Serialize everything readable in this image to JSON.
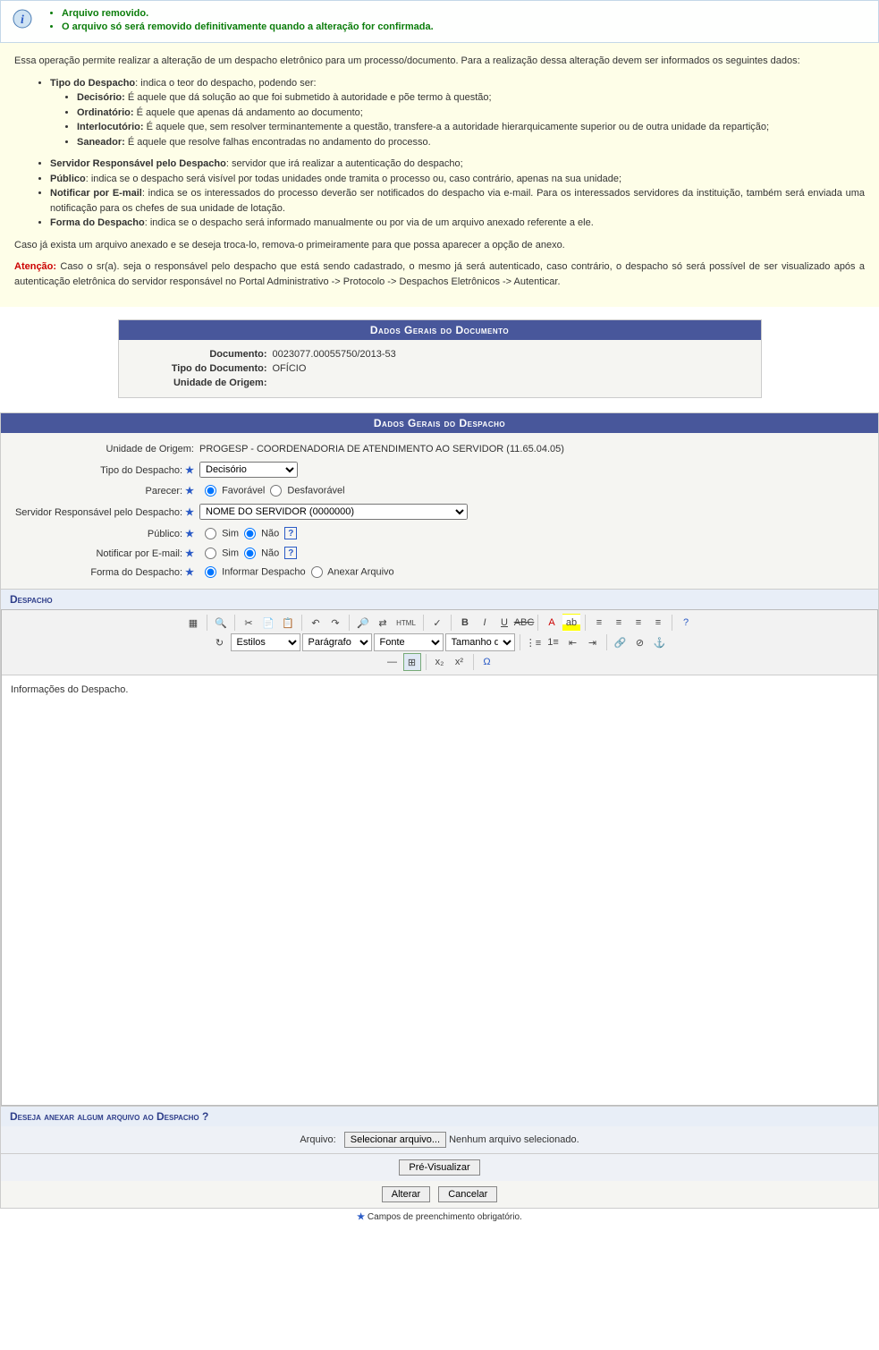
{
  "info_messages": [
    "Arquivo removido.",
    "O arquivo só será removido definitivamente quando a alteração for confirmada."
  ],
  "instructions": {
    "intro": "Essa operação permite realizar a alteração de um despacho eletrônico para um processo/documento. Para a realização dessa alteração devem ser informados os seguintes dados:",
    "items": {
      "tipo_despacho": {
        "label": "Tipo do Despacho",
        "text": ": indica o teor do despacho, podendo ser:"
      },
      "decisorio": {
        "label": "Decisório:",
        "text": " É aquele que dá solução ao que foi submetido à autoridade e põe termo à questão;"
      },
      "ordinatorio": {
        "label": "Ordinatório:",
        "text": " É aquele que apenas dá andamento ao documento;"
      },
      "interlocutorio": {
        "label": "Interlocutório:",
        "text": " É aquele que, sem resolver terminantemente a questão, transfere-a a autoridade hierarquicamente superior ou de outra unidade da repartição;"
      },
      "saneador": {
        "label": "Saneador:",
        "text": " É aquele que resolve falhas encontradas no andamento do processo."
      },
      "servidor": {
        "label": "Servidor Responsável pelo Despacho",
        "text": ": servidor que irá realizar a autenticação do despacho;"
      },
      "publico": {
        "label": "Público",
        "text": ": indica se o despacho será visível por todas unidades onde tramita o processo ou, caso contrário, apenas na sua unidade;"
      },
      "notificar": {
        "label": "Notificar por E-mail",
        "text": ": indica se os interessados do processo deverão ser notificados do despacho via e-mail. Para os interessados servidores da instituição, também será enviada uma notificação para os chefes de sua unidade de lotação."
      },
      "forma": {
        "label": "Forma do Despacho",
        "text": ": indica se o despacho será informado manualmente ou por via de um arquivo anexado referente a ele."
      }
    },
    "swap_note": "Caso já exista um arquivo anexado e se deseja troca-lo, remova-o primeiramente para que possa aparecer a opção de anexo.",
    "attention_label": "Atenção:",
    "attention_text": " Caso o sr(a). seja o responsável pelo despacho que está sendo cadastrado, o mesmo já será autenticado, caso contrário, o despacho só será possível de ser visualizado após a autenticação eletrônica do servidor responsável no Portal Administrativo -> Protocolo -> Despachos Eletrônicos -> Autenticar."
  },
  "doc_panel": {
    "title": "Dados Gerais do Documento",
    "documento_label": "Documento:",
    "documento_value": "0023077.00055750/2013-53",
    "tipo_label": "Tipo do Documento:",
    "tipo_value": "OFÍCIO",
    "origem_label": "Unidade de Origem:",
    "origem_value": ""
  },
  "despacho_panel": {
    "title": "Dados Gerais do Despacho",
    "unidade_label": "Unidade de Origem:",
    "unidade_value": "PROGESP - COORDENADORIA DE ATENDIMENTO AO SERVIDOR (11.65.04.05)",
    "tipo_label": "Tipo do Despacho:",
    "tipo_options": [
      "Decisório"
    ],
    "parecer_label": "Parecer:",
    "parecer_fav": "Favorável",
    "parecer_desfav": "Desfavorável",
    "servidor_label": "Servidor Responsável pelo Despacho:",
    "servidor_value": "NOME DO SERVIDOR (0000000)",
    "publico_label": "Público:",
    "sim": "Sim",
    "nao": "Não",
    "notificar_label": "Notificar por E-mail:",
    "forma_label": "Forma do Despacho:",
    "forma_informar": "Informar Despacho",
    "forma_anexar": "Anexar Arquivo"
  },
  "editor": {
    "section_title": "Despacho",
    "styles_label": "Estilos",
    "paragraph_label": "Parágrafo",
    "font_label": "Fonte",
    "size_label": "Tamanho da Fo",
    "content": "Informações do Despacho."
  },
  "attach": {
    "section_title": "Deseja anexar algum arquivo ao Despacho ?",
    "arquivo_label": "Arquivo:",
    "select_btn": "Selecionar arquivo...",
    "no_file": "Nenhum arquivo selecionado."
  },
  "actions": {
    "preview": "Pré-Visualizar",
    "alterar": "Alterar",
    "cancelar": "Cancelar"
  },
  "footnote": "Campos de preenchimento obrigatório."
}
